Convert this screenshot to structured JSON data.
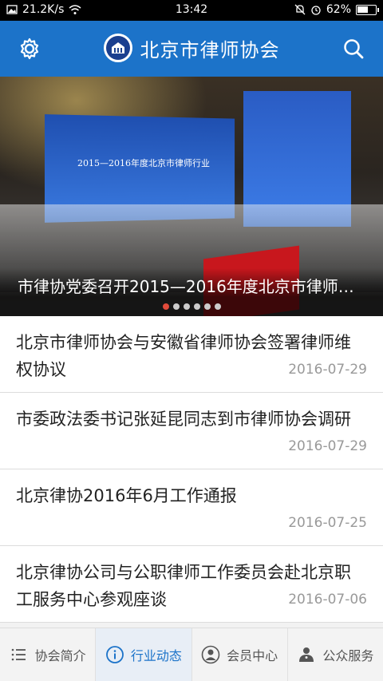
{
  "status_bar": {
    "network_speed": "21.2K/s",
    "time": "13:42",
    "battery": "62%",
    "battery_level": 0.62
  },
  "app_bar": {
    "title": "北京市律师协会"
  },
  "banner": {
    "screen_text": "2015—2016年度北京市律师行业",
    "caption": "市律协党委召开2015—2016年度北京市律师…",
    "dots_total": 6,
    "dots_active_index": 0
  },
  "news": [
    {
      "title": "北京市律师协会与安徽省律师协会签署律师维权协议",
      "date": "2016-07-29"
    },
    {
      "title": "市委政法委书记张延昆同志到市律师协会调研",
      "date": "2016-07-29"
    },
    {
      "title": "北京律协2016年6月工作通报",
      "date": "2016-07-25"
    },
    {
      "title": "北京律协公司与公职律师工作委员会赴北京职工服务中心参观座谈",
      "date": "2016-07-06"
    }
  ],
  "tabs": [
    {
      "label": "协会简介",
      "icon": "list-icon"
    },
    {
      "label": "行业动态",
      "icon": "info-icon"
    },
    {
      "label": "会员中心",
      "icon": "person-icon"
    },
    {
      "label": "公众服务",
      "icon": "people-icon"
    }
  ],
  "colors": {
    "primary": "#1c73c9",
    "dot_active": "#e24b3b"
  }
}
